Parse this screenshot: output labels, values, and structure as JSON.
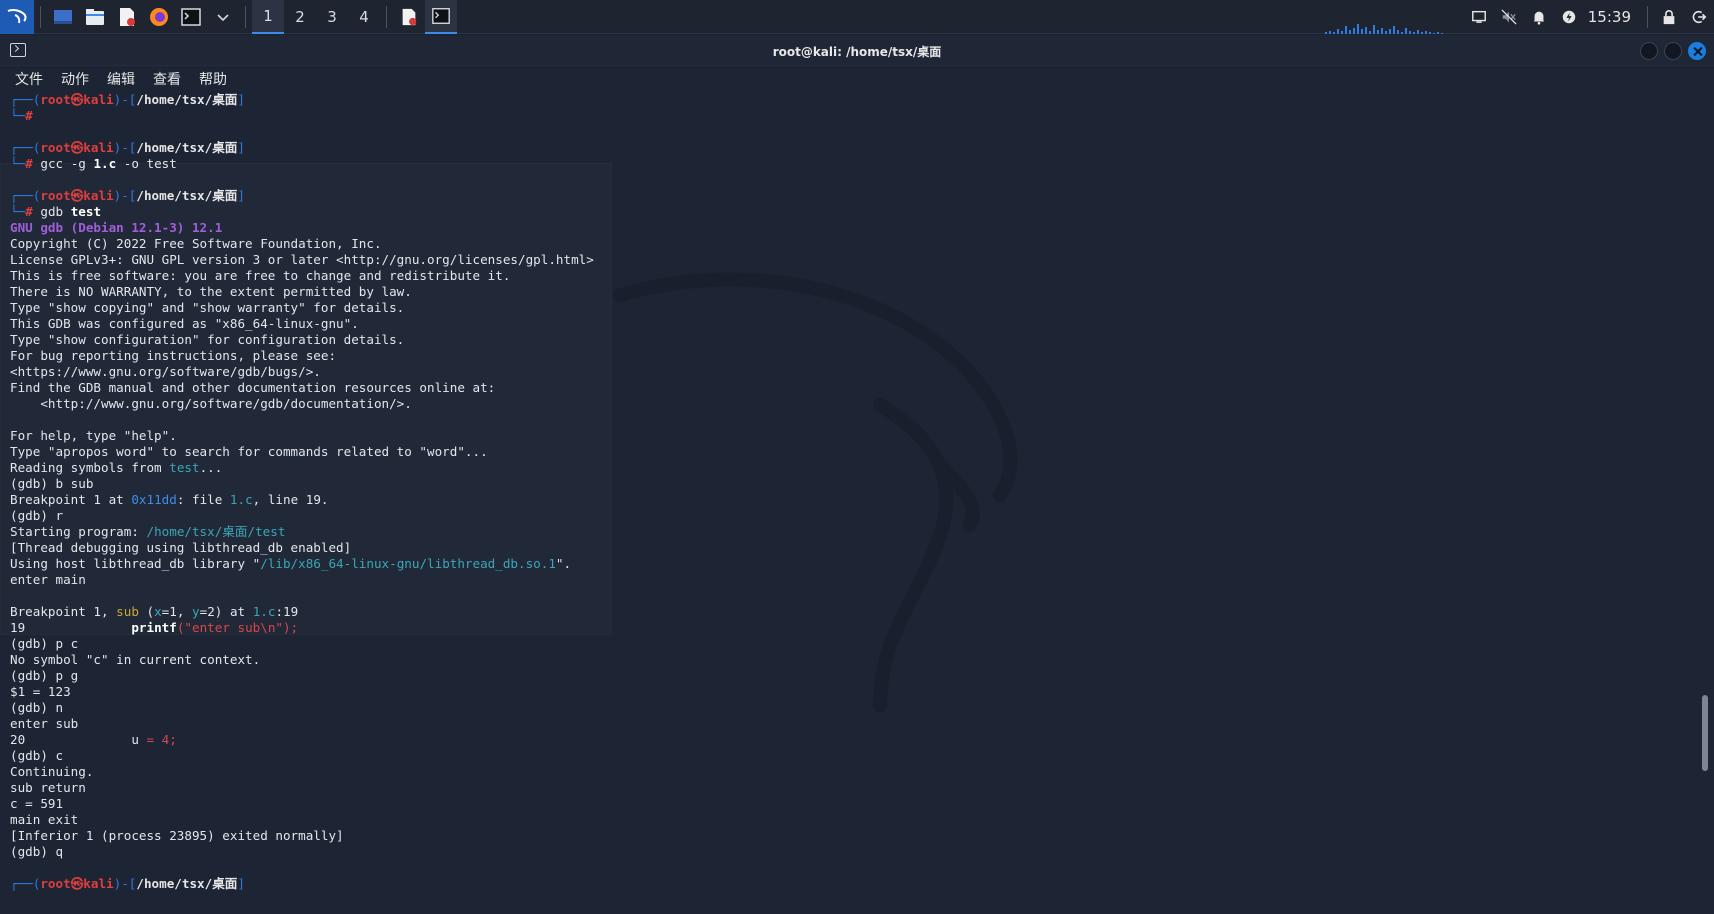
{
  "taskbar": {
    "workspaces": [
      "1",
      "2",
      "3",
      "4"
    ],
    "active_workspace": "1",
    "clock": "15:39",
    "pinned_icons": [
      "kali-menu-icon",
      "desktop-icon",
      "file-manager-icon",
      "text-editor-icon",
      "firefox-icon",
      "terminal-icon",
      "chevron-down-icon"
    ],
    "tasks": [
      "text-editor-icon",
      "terminal-icon"
    ],
    "tray_icons": [
      "display-icon",
      "mute-icon",
      "bell-icon",
      "power-icon",
      "lock-icon",
      "logout-icon"
    ],
    "accent": "#3d8be8"
  },
  "window": {
    "title": "root@kali: /home/tsx/桌面"
  },
  "menu": [
    "文件",
    "动作",
    "编辑",
    "查看",
    "帮助"
  ],
  "terminal": {
    "prompt": {
      "user": "root",
      "host": "kali",
      "at": "㉿",
      "path": "/home/tsx/桌面",
      "hash": "#"
    },
    "cmd1": "",
    "cmd2_pre": "gcc -g ",
    "cmd2_bold": "1.c",
    "cmd2_post": " -o test",
    "cmd3_pre": "gdb ",
    "cmd3_bold": "test",
    "lines": {
      "gdb_version": "GNU gdb (Debian 12.1-3) 12.1",
      "l1": "Copyright (C) 2022 Free Software Foundation, Inc.",
      "l2": "License GPLv3+: GNU GPL version 3 or later <http://gnu.org/licenses/gpl.html>",
      "l3": "This is free software: you are free to change and redistribute it.",
      "l4": "There is NO WARRANTY, to the extent permitted by law.",
      "l5": "Type \"show copying\" and \"show warranty\" for details.",
      "l6": "This GDB was configured as \"x86_64-linux-gnu\".",
      "l7": "Type \"show configuration\" for configuration details.",
      "l8": "For bug reporting instructions, please see:",
      "l9": "<https://www.gnu.org/software/gdb/bugs/>.",
      "l10": "Find the GDB manual and other documentation resources online at:",
      "l11": "    <http://www.gnu.org/software/gdb/documentation/>.",
      "l12": "",
      "l13": "For help, type \"help\".",
      "l14": "Type \"apropos word\" to search for commands related to \"word\"...",
      "l15_pre": "Reading symbols from ",
      "l15_file": "test",
      "l15_post": "...",
      "l16": "(gdb) b sub",
      "l17_pre": "Breakpoint 1 at ",
      "l17_addr": "0x11dd",
      "l17_mid": ": file ",
      "l17_file": "1.c",
      "l17_post": ", line 19.",
      "l18": "(gdb) r",
      "l19_pre": "Starting program: ",
      "l19_path": "/home/tsx/桌面/test",
      "l20": "[Thread debugging using libthread_db enabled]",
      "l21_pre": "Using host libthread_db library \"",
      "l21_path": "/lib/x86_64-linux-gnu/libthread_db.so.1",
      "l21_post": "\".",
      "l22": "enter main",
      "l23": "",
      "l24_pre": "Breakpoint 1, ",
      "l24_fn": "sub",
      "l24_a": " (",
      "l24_x": "x",
      "l24_b": "=1, ",
      "l24_y": "y",
      "l24_c": "=2) at ",
      "l24_file": "1.c",
      "l24_post": ":19",
      "l25_num": "19              ",
      "l25_fn": "printf",
      "l25_str": "(\"enter sub\\n\");",
      "l26": "(gdb) p c",
      "l27": "No symbol \"c\" in current context.",
      "l28": "(gdb) p g",
      "l29": "$1 = 123",
      "l30": "(gdb) n",
      "l31": "enter sub",
      "l32_num": "20              u ",
      "l32_rest": "= 4;",
      "l33": "(gdb) c",
      "l34": "Continuing.",
      "l35": "sub return",
      "l36": "c = 591",
      "l37": "main exit",
      "l38": "[Inferior 1 (process 23895) exited normally]",
      "l39": "(gdb) q"
    }
  }
}
